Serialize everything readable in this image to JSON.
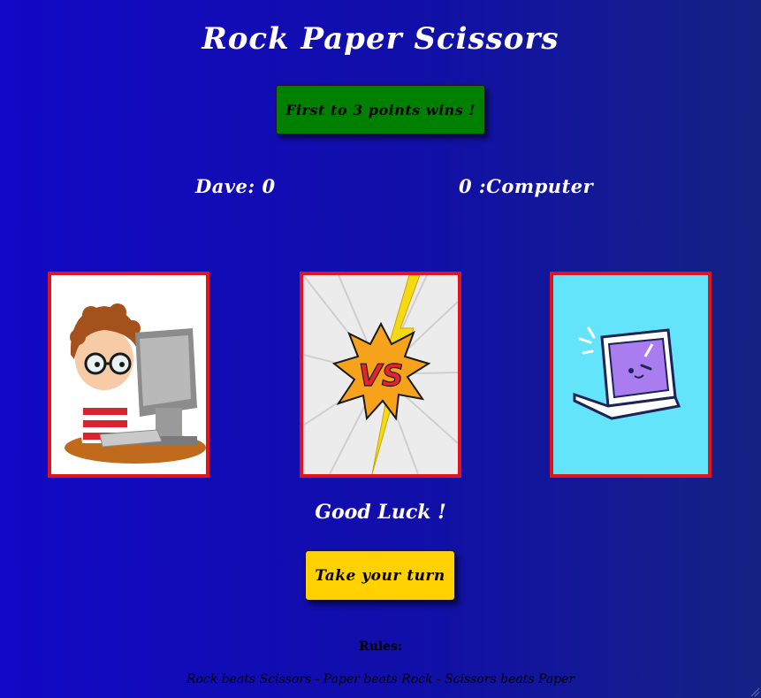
{
  "game": {
    "title": "Rock Paper Scissors",
    "goal_button": "First to 3 points wins !",
    "player_score": "Dave: 0",
    "computer_score": "0 :Computer",
    "message": "Good Luck !",
    "turn_button": "Take your turn"
  },
  "cards": {
    "player": {
      "icon": "boy-at-computer-icon"
    },
    "versus": {
      "icon": "versus-burst-icon",
      "text": "VS"
    },
    "computer": {
      "icon": "winking-laptop-icon"
    }
  },
  "rules": {
    "heading": "Rules:",
    "text": "Rock beats Scissors - Paper beats Rock - Scissors beats Paper"
  },
  "colors": {
    "background": "#1208c6",
    "goal_button": "#008000",
    "turn_button": "#ffd100",
    "card_border": "#e0141f"
  }
}
